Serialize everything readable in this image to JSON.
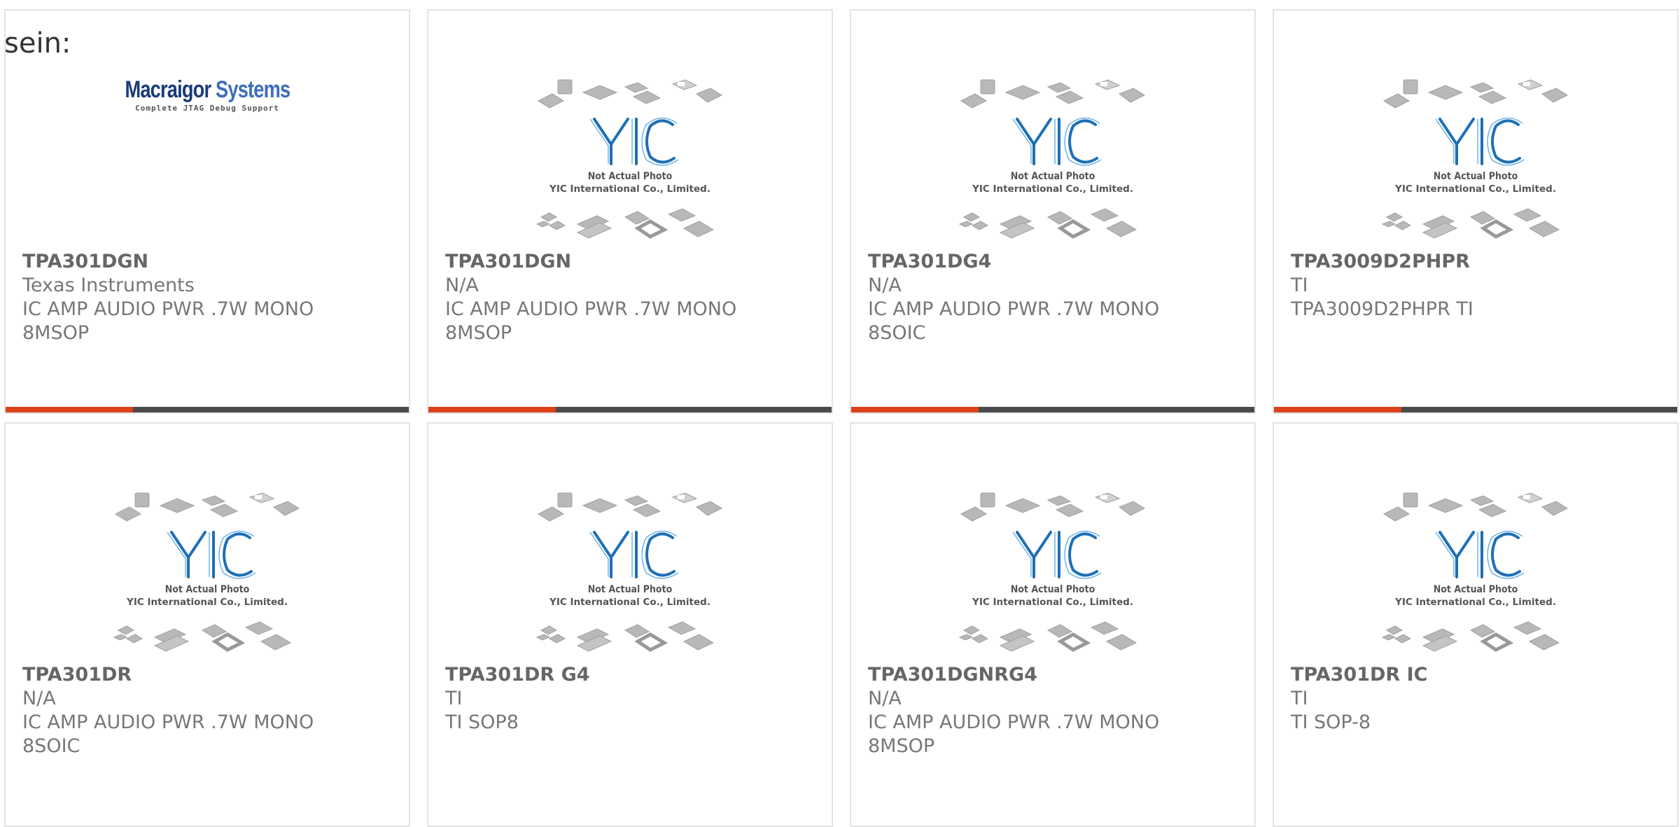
{
  "page": {
    "heading": "sein:"
  },
  "placeholder": {
    "line1": "Not Actual Photo",
    "line2": "YIC International Co., Limited.",
    "logo": "YIC"
  },
  "brand_logo": {
    "name_a": "Macraigor",
    "name_b": "Systems",
    "tagline": "Complete JTAG Debug Support"
  },
  "colors": {
    "accent": "#dc4118",
    "bar": "#4a4a4a",
    "border": "#e3e3e3",
    "logo_blue": "#1e6fb6"
  },
  "products": [
    {
      "part": "TPA301DGN",
      "mfr": "Texas Instruments",
      "desc": "IC AMP AUDIO PWR .7W MONO 8MSOP",
      "image": "macraigor-logo",
      "bar": true
    },
    {
      "part": "TPA301DGN",
      "mfr": "N/A",
      "desc": "IC AMP AUDIO PWR .7W MONO 8MSOP",
      "image": "yic-placeholder",
      "bar": true
    },
    {
      "part": "TPA301DG4",
      "mfr": "N/A",
      "desc": "IC AMP AUDIO PWR .7W MONO 8SOIC",
      "image": "yic-placeholder",
      "bar": true
    },
    {
      "part": "TPA3009D2PHPR",
      "mfr": "TI",
      "desc": "TPA3009D2PHPR TI",
      "image": "yic-placeholder",
      "bar": true
    },
    {
      "part": "TPA301DR",
      "mfr": "N/A",
      "desc": "IC AMP AUDIO PWR .7W MONO 8SOIC",
      "image": "yic-placeholder",
      "bar": false
    },
    {
      "part": "TPA301DR G4",
      "mfr": "TI",
      "desc": "TI SOP8",
      "image": "yic-placeholder",
      "bar": false
    },
    {
      "part": "TPA301DGNRG4",
      "mfr": "N/A",
      "desc": "IC AMP AUDIO PWR .7W MONO 8MSOP",
      "image": "yic-placeholder",
      "bar": false
    },
    {
      "part": "TPA301DR IC",
      "mfr": "TI",
      "desc": "TI SOP-8",
      "image": "yic-placeholder",
      "bar": false
    }
  ]
}
